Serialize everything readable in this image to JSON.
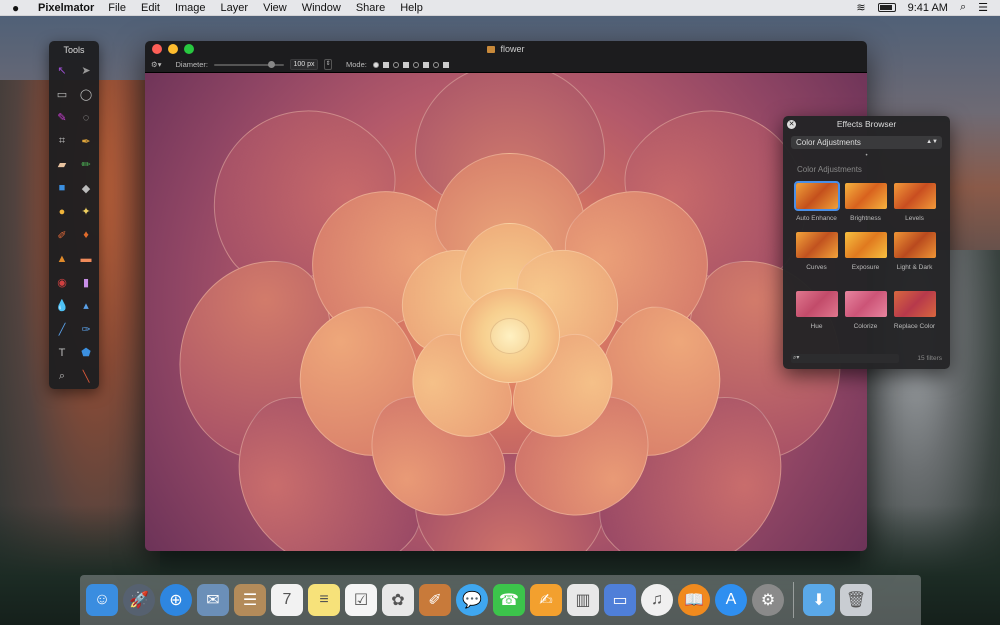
{
  "menubar": {
    "app_name": "Pixelmator",
    "menus": [
      "File",
      "Edit",
      "Image",
      "Layer",
      "View",
      "Window",
      "Share",
      "Help"
    ],
    "time": "9:41 AM"
  },
  "tools": {
    "title": "Tools",
    "items": [
      {
        "name": "arrange-icon",
        "glyph": "↖"
      },
      {
        "name": "move-icon",
        "glyph": "➤"
      },
      {
        "name": "rect-select-icon",
        "glyph": "▭"
      },
      {
        "name": "ellipse-select-icon",
        "glyph": "◯"
      },
      {
        "name": "paint-select-icon",
        "glyph": "✎"
      },
      {
        "name": "lasso-icon",
        "glyph": "◌"
      },
      {
        "name": "crop-icon",
        "glyph": "⌗"
      },
      {
        "name": "eyedropper-icon",
        "glyph": "✒"
      },
      {
        "name": "eraser-icon",
        "glyph": "▰"
      },
      {
        "name": "pencil-icon",
        "glyph": "✏"
      },
      {
        "name": "fill-icon",
        "glyph": "■"
      },
      {
        "name": "paint-bucket-icon",
        "glyph": "◆"
      },
      {
        "name": "sponge-icon",
        "glyph": "●"
      },
      {
        "name": "magic-wand-icon",
        "glyph": "✦"
      },
      {
        "name": "brush-icon",
        "glyph": "✐"
      },
      {
        "name": "burn-icon",
        "glyph": "♦"
      },
      {
        "name": "stamp-icon",
        "glyph": "▲"
      },
      {
        "name": "bandage-icon",
        "glyph": "▬"
      },
      {
        "name": "red-eye-icon",
        "glyph": "◉"
      },
      {
        "name": "light-eraser-icon",
        "glyph": "▮"
      },
      {
        "name": "drop-icon",
        "glyph": "💧"
      },
      {
        "name": "sharpen-icon",
        "glyph": "▴"
      },
      {
        "name": "smudge-icon",
        "glyph": "╱"
      },
      {
        "name": "pen-icon",
        "glyph": "✑"
      },
      {
        "name": "type-icon",
        "glyph": "T"
      },
      {
        "name": "shape-icon",
        "glyph": "⬟"
      },
      {
        "name": "zoom-icon",
        "glyph": "⌕"
      },
      {
        "name": "color-picker-icon",
        "glyph": "╲"
      }
    ]
  },
  "window": {
    "title": "flower",
    "options": {
      "diameter_label": "Diameter:",
      "diameter_value": "100 px",
      "mode_label": "Mode:"
    }
  },
  "effects": {
    "title": "Effects Browser",
    "category": "Color Adjustments",
    "section_label": "Color Adjustments",
    "filters": [
      {
        "label": "Auto Enhance",
        "colors": [
          "#f0a13a",
          "#c4501c"
        ],
        "selected": true
      },
      {
        "label": "Brightness",
        "colors": [
          "#f6b33f",
          "#d8621e"
        ],
        "selected": false
      },
      {
        "label": "Levels",
        "colors": [
          "#f29a3a",
          "#c94e20"
        ],
        "selected": false
      },
      {
        "label": "Curves",
        "colors": [
          "#f3a43b",
          "#c1521f"
        ],
        "selected": false
      },
      {
        "label": "Exposure",
        "colors": [
          "#f7c040",
          "#e07a1f"
        ],
        "selected": false
      },
      {
        "label": "Light & Dark",
        "colors": [
          "#ef9636",
          "#b94a1e"
        ],
        "selected": false
      },
      {
        "label": "Hue",
        "colors": [
          "#e0778e",
          "#c24b6a"
        ],
        "selected": false
      },
      {
        "label": "Colorize",
        "colors": [
          "#e7859f",
          "#cc5477"
        ],
        "selected": false
      },
      {
        "label": "Replace Color",
        "colors": [
          "#d9673f",
          "#b7394b"
        ],
        "selected": false
      }
    ],
    "search_placeholder": "",
    "count": "15 filters"
  },
  "dock": {
    "items": [
      {
        "name": "finder-icon",
        "glyph": "☺",
        "bg": "#3a8de0"
      },
      {
        "name": "launchpad-icon",
        "glyph": "🚀",
        "bg": "#566170"
      },
      {
        "name": "safari-icon",
        "glyph": "⊕",
        "bg": "#2e86e0"
      },
      {
        "name": "mail-icon",
        "glyph": "✉",
        "bg": "#6b8fb8"
      },
      {
        "name": "contacts-icon",
        "glyph": "☰",
        "bg": "#b38b5a"
      },
      {
        "name": "calendar-icon",
        "glyph": "7",
        "bg": "#f2f2f2"
      },
      {
        "name": "notes-icon",
        "glyph": "≡",
        "bg": "#f7e27a"
      },
      {
        "name": "reminders-icon",
        "glyph": "☑",
        "bg": "#f5f5f5"
      },
      {
        "name": "photos-icon",
        "glyph": "✿",
        "bg": "#e8e8e8"
      },
      {
        "name": "pixelmator-icon",
        "glyph": "✐",
        "bg": "#c87a3a"
      },
      {
        "name": "messages-icon",
        "glyph": "💬",
        "bg": "#3fa7f0"
      },
      {
        "name": "facetime-icon",
        "glyph": "☎",
        "bg": "#3cc44b"
      },
      {
        "name": "pages-icon",
        "glyph": "✍",
        "bg": "#f3a02e"
      },
      {
        "name": "numbers-icon",
        "glyph": "▥",
        "bg": "#e8e8e8"
      },
      {
        "name": "keynote-icon",
        "glyph": "▭",
        "bg": "#4f7fd8"
      },
      {
        "name": "itunes-icon",
        "glyph": "♫",
        "bg": "#f0f0f0"
      },
      {
        "name": "ibooks-icon",
        "glyph": "📖",
        "bg": "#f08a1e"
      },
      {
        "name": "app-store-icon",
        "glyph": "A",
        "bg": "#2f8ff0"
      },
      {
        "name": "system-preferences-icon",
        "glyph": "⚙",
        "bg": "#8a8a8a"
      }
    ],
    "trailing": [
      {
        "name": "downloads-icon",
        "glyph": "⬇",
        "bg": "#5aa8e8"
      },
      {
        "name": "trash-icon",
        "glyph": "🗑",
        "bg": "#c9cdd2"
      }
    ]
  }
}
